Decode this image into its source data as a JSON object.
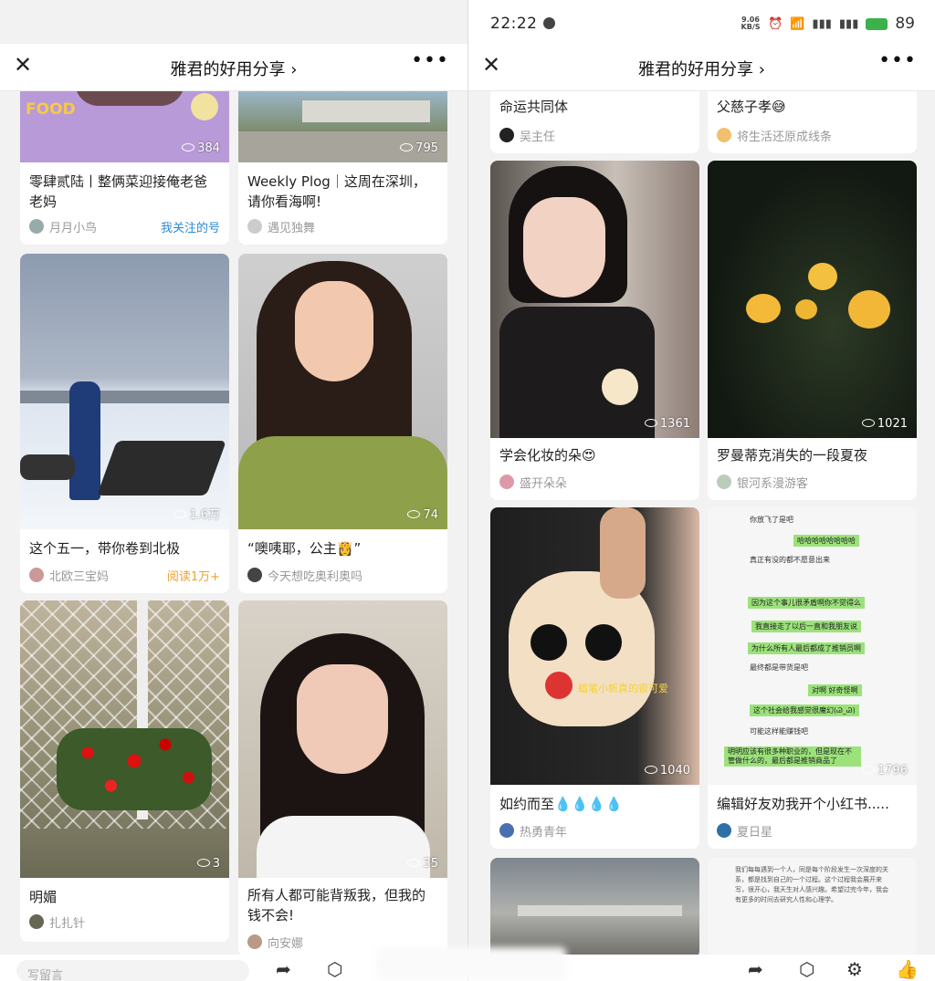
{
  "left": {
    "header": {
      "title": "雅君的好用分享 ›",
      "close_icon": "close-icon",
      "more_label": "•••"
    },
    "cards": [
      {
        "views": "384",
        "title": "零肆贰陆丨整俩菜迎接俺老爸老妈",
        "author": "月月小鸟",
        "tag": "我关注的号",
        "image_text": "FOOD"
      },
      {
        "views": "795",
        "title": "Weekly Plog｜这周在深圳，请你看海啊!",
        "author": "遇见独舞"
      },
      {
        "views": "1.6万",
        "title": "这个五一，带你卷到北极",
        "author": "北欧三宝妈",
        "tag": "阅读1万+"
      },
      {
        "views": "74",
        "title": "“噢咦耶，公主👸”",
        "author": "今天想吃奥利奥吗"
      },
      {
        "views": "3",
        "title": "明媚",
        "author": "扎扎针"
      },
      {
        "views": "35",
        "title": "所有人都可能背叛我，但我的钱不会!",
        "author": "向安娜"
      }
    ],
    "bottom": {
      "comment_placeholder": "写留言"
    }
  },
  "right": {
    "status": {
      "time": "22:22",
      "netspeed": "9.06 KB/S",
      "battery": "89"
    },
    "header": {
      "title": "雅君的好用分享 ›",
      "close_icon": "close-icon",
      "more_label": "•••"
    },
    "cards": [
      {
        "title": "命运共同体",
        "author": "吴主任"
      },
      {
        "title": "父慈子孝😅",
        "author": "将生活还原成线条"
      },
      {
        "views": "1361",
        "title": "学会化妆的朵😍",
        "author": "盛开朵朵"
      },
      {
        "views": "1021",
        "title": "罗曼蒂克消失的一段夏夜",
        "author": "银河系漫游客"
      },
      {
        "views": "1040",
        "title": "如约而至💧💧💧💧",
        "author": "热勇青年",
        "image_caption": "蜡笔小新真的很可爱"
      },
      {
        "views": "1796",
        "title": "编辑好友劝我开个小红书.....",
        "author": "夏日星",
        "chat": [
          "你放飞了是吧",
          "哈哈哈哈哈哈哈哈",
          "真正有没的都不愿意出来",
          "因为这个事儿很矛盾啊你不觉得么",
          "我直接走了以后一直和我朋友说",
          "为什么所有人最后都成了推销员啊",
          "最终都是带货是吧",
          "对啊 好奇怪啊",
          "这个社会给我感觉很魔幻(Ꮚ_Ꮚ)",
          "可能这样能赚钱吧",
          "明明应该有很多种职业的，但是现在不管做什么的，最后都是推销商品了"
        ]
      },
      {
        "title": "",
        "author": ""
      },
      {
        "title": "",
        "author": "",
        "doc_text": "我们每每遇到一个人，同是每个阶段发生一次深度的关系，都是找到自己的一个过程。这个过程我会展开来写，很开心，我天生对人感兴趣。希望过完今年，我会有更多的时间去研究人性和心理学。"
      }
    ]
  }
}
